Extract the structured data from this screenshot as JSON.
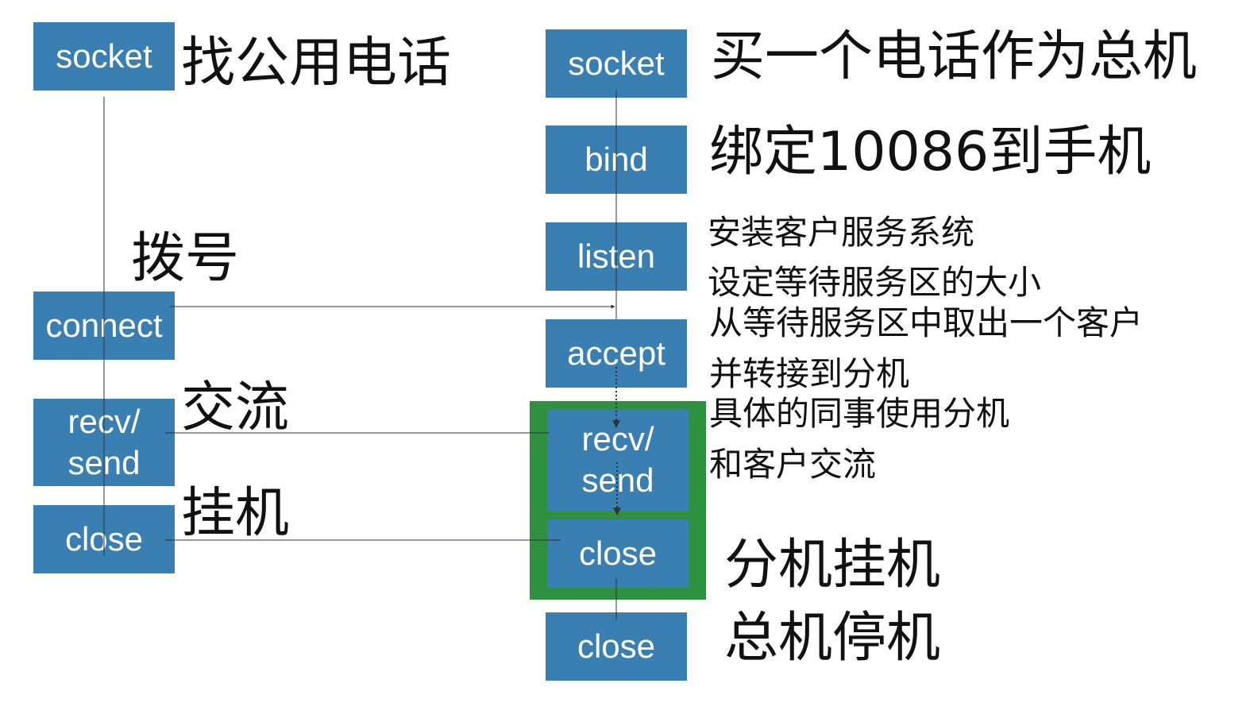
{
  "client": {
    "socket": "socket",
    "connect": "connect",
    "recv_send": "recv/\nsend",
    "close": "close",
    "note_socket": "找公用电话",
    "note_connect": "拨号",
    "note_exchange": "交流",
    "note_close": "挂机"
  },
  "server": {
    "socket": "socket",
    "bind": "bind",
    "listen": "listen",
    "accept": "accept",
    "recv_send": "recv/\nsend",
    "close_child": "close",
    "close": "close",
    "note_socket": "买一个电话作为总机",
    "note_bind": "绑定10086到手机",
    "note_listen_1": "安装客户服务系统",
    "note_listen_2": "设定等待服务区的大小",
    "note_accept_1": "从等待服务区中取出一个客户",
    "note_accept_2": "并转接到分机",
    "note_recv_1": "具体的同事使用分机",
    "note_recv_2": "和客户交流",
    "note_close_child": "分机挂机",
    "note_close": "总机停机"
  },
  "colors": {
    "box": "#3a7fb2",
    "child_process": "#2e9140",
    "line": "#333333"
  }
}
